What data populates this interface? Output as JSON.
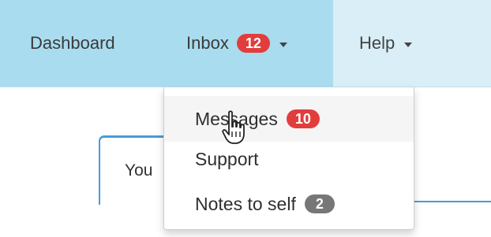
{
  "navbar": {
    "dashboard_label": "Dashboard",
    "inbox_label": "Inbox",
    "inbox_badge": "12",
    "help_label": "Help"
  },
  "dropdown": {
    "items": [
      {
        "label": "Messages",
        "badge": "10"
      },
      {
        "label": "Support"
      },
      {
        "label": "Notes to self",
        "badge": "2"
      }
    ]
  },
  "background": {
    "tab_text": "You"
  },
  "colors": {
    "navbar_bg": "#d9eef6",
    "active_nav_bg": "#a9dcee",
    "badge_red": "#e23d3d",
    "badge_grey": "#777777",
    "tab_accent": "#4a9ad7"
  },
  "icons": {
    "cursor": "hand-pointer-icon",
    "caret": "caret-down-icon"
  }
}
